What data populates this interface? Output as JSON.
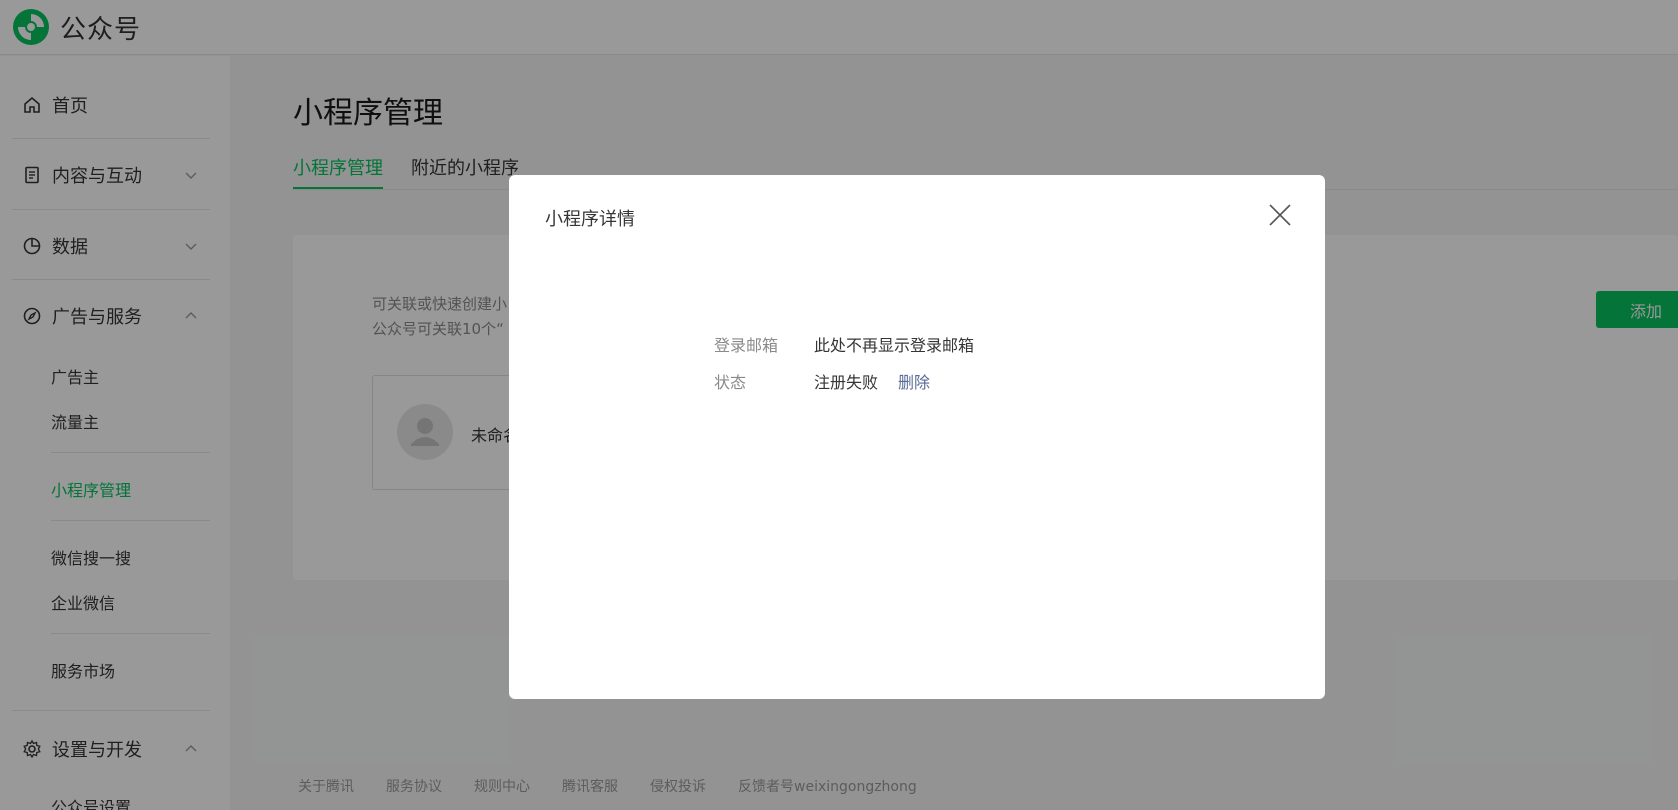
{
  "header": {
    "logo_text": "公众号",
    "logo_icon": "wechat-official-accounts-logo"
  },
  "sidebar": {
    "items": [
      {
        "label": "首页",
        "icon": "home-icon"
      },
      {
        "label": "内容与互动",
        "icon": "document-icon",
        "expanded": false
      },
      {
        "label": "数据",
        "icon": "pie-chart-icon",
        "expanded": false
      },
      {
        "label": "广告与服务",
        "icon": "compass-icon",
        "expanded": true
      },
      {
        "label": "设置与开发",
        "icon": "gear-icon",
        "expanded": true
      }
    ],
    "ads_sub": [
      "广告主",
      "流量主",
      "小程序管理",
      "微信搜一搜",
      "企业微信",
      "服务市场"
    ],
    "settings_sub": [
      "公众号设置"
    ],
    "active_sub": "小程序管理"
  },
  "main": {
    "title": "小程序管理",
    "tabs": [
      {
        "label": "小程序管理",
        "active": true
      },
      {
        "label": "附近的小程序",
        "active": false
      }
    ],
    "card": {
      "desc_line1": "可关联或快速创建小",
      "desc_line2": "公众号可关联10个“",
      "app_name": "未命名",
      "add_button": "添加"
    }
  },
  "footer": {
    "links": [
      "关于腾讯",
      "服务协议",
      "规则中心",
      "腾讯客服",
      "侵权投诉",
      "反馈者号weixingongzhong"
    ]
  },
  "dialog": {
    "title": "小程序详情",
    "rows": [
      {
        "label": "登录邮箱",
        "value": "此处不再显示登录邮箱"
      },
      {
        "label": "状态",
        "value": "注册失败",
        "link": "删除"
      }
    ]
  },
  "colors": {
    "accent": "#07c160",
    "link": "#576b95",
    "overlay": "rgba(0,0,0,0.4)"
  }
}
